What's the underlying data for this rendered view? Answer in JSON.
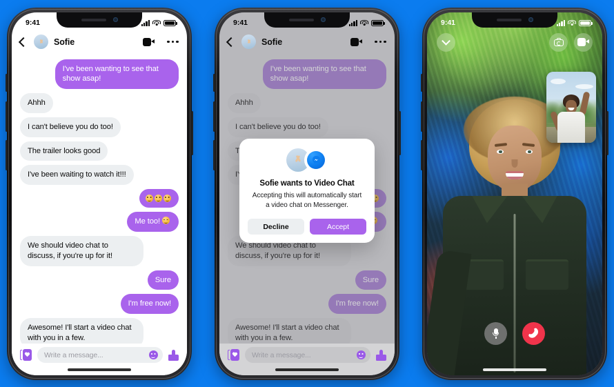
{
  "background_color": "#0b7cef",
  "theme": {
    "purple": "#a963ec",
    "bubble_in": "#eceff1",
    "messenger_blue": "#0d7ef0",
    "end_call_red": "#f0344b"
  },
  "status_bar": {
    "time": "9:41",
    "signal": "signal-bars",
    "wifi": "wifi-icon",
    "battery": "battery-icon"
  },
  "chat": {
    "contact_name": "Sofie",
    "back_label": "Back",
    "video_call_label": "Video call",
    "more_label": "More options",
    "messages": [
      {
        "id": 1,
        "side": "out",
        "text": "I've been wanting to see that show asap!"
      },
      {
        "id": 2,
        "side": "in",
        "text": "Ahhh"
      },
      {
        "id": 3,
        "side": "in",
        "text": "I can't believe you do too!"
      },
      {
        "id": 4,
        "side": "in",
        "text": "The trailer looks good"
      },
      {
        "id": 5,
        "side": "in",
        "text": "I've been waiting to watch it!!!"
      },
      {
        "id": 6,
        "side": "out",
        "type": "emoji",
        "text": ""
      },
      {
        "id": 7,
        "side": "out",
        "type": "emoji_text",
        "text": "Me too!"
      },
      {
        "id": 8,
        "side": "in",
        "text": "We should video chat to discuss, if you're up for it!"
      },
      {
        "id": 9,
        "side": "out",
        "text": "Sure"
      },
      {
        "id": 10,
        "side": "out",
        "text": "I'm free now!"
      },
      {
        "id": 11,
        "side": "in",
        "text": "Awesome! I'll start a video chat with you in a few."
      }
    ],
    "composer": {
      "sticker_label": "Stickers",
      "placeholder": "Write a message...",
      "emoji_label": "Emoji",
      "like_label": "Like"
    }
  },
  "modal": {
    "title": "Sofie wants to Video Chat",
    "subtitle": "Accepting this will automatically start a video chat on Messenger.",
    "decline_label": "Decline",
    "accept_label": "Accept",
    "app_badge": "messenger-logo"
  },
  "call": {
    "minimize_label": "Minimize",
    "flip_camera_label": "Flip camera",
    "toggle_video_label": "Toggle video",
    "mute_label": "Mute",
    "end_call_label": "End call",
    "self_view_label": "Self view"
  }
}
